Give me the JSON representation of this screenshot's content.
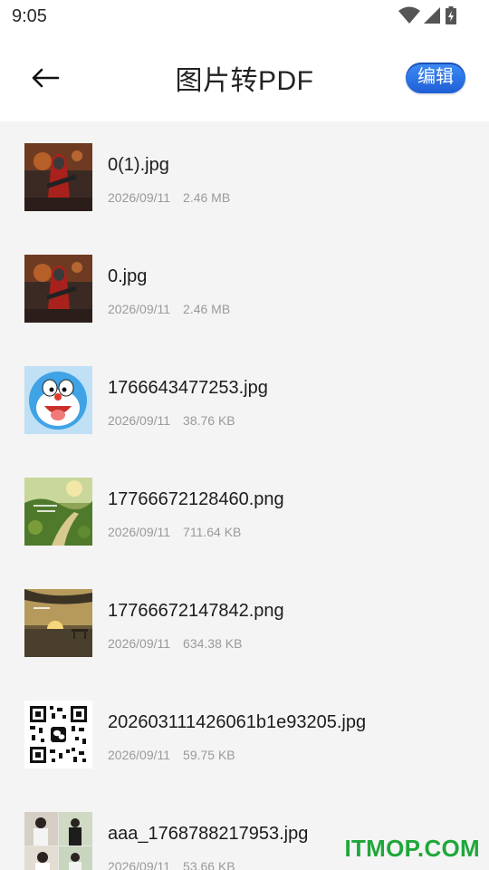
{
  "status_bar": {
    "time": "9:05"
  },
  "header": {
    "title": "图片转PDF",
    "edit_label": "编辑"
  },
  "files": [
    {
      "name": "0(1).jpg",
      "date": "2026/09/11",
      "size": "2.46 MB",
      "thumb": "hooded-warrior"
    },
    {
      "name": "0.jpg",
      "date": "2026/09/11",
      "size": "2.46 MB",
      "thumb": "hooded-warrior"
    },
    {
      "name": "1766643477253.jpg",
      "date": "2026/09/11",
      "size": "38.76 KB",
      "thumb": "blue-cartoon-cat"
    },
    {
      "name": "17766672128460.png",
      "date": "2026/09/11",
      "size": "711.64 KB",
      "thumb": "green-landscape"
    },
    {
      "name": "17766672147842.png",
      "date": "2026/09/11",
      "size": "634.38 KB",
      "thumb": "sunset-bench"
    },
    {
      "name": "202603111426061b1e93205.jpg",
      "date": "2026/09/11",
      "size": "59.75 KB",
      "thumb": "qr-code"
    },
    {
      "name": "aaa_1768788217953.jpg",
      "date": "2026/09/11",
      "size": "53.66 KB",
      "thumb": "photo-collage"
    }
  ],
  "watermark": "ITMOP.COM",
  "colors": {
    "accent": "#2f76e8",
    "watermark": "#1fa73a",
    "background": "#f4f4f5"
  }
}
